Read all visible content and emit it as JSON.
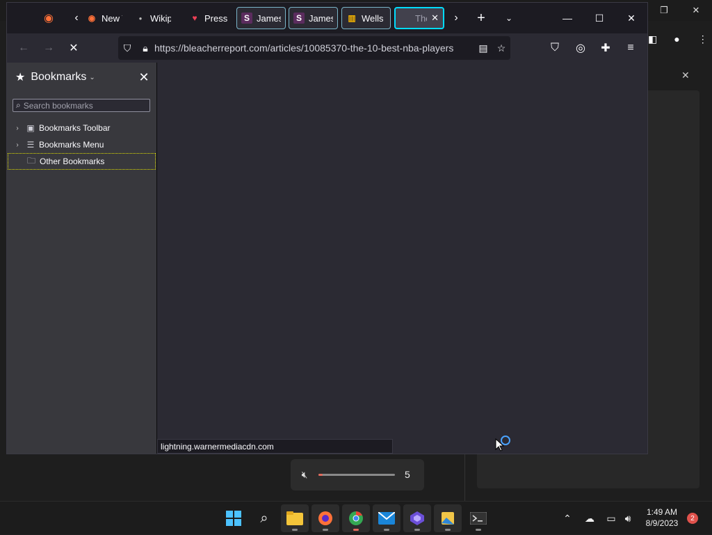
{
  "browser": {
    "tabs": [
      {
        "label": "New T",
        "icon": "firefox-icon"
      },
      {
        "label": "Wikip",
        "icon": "wikipedia-icon"
      },
      {
        "label": "Pressu",
        "icon": "pocket-icon"
      },
      {
        "label": "James",
        "icon": "s-logo-icon"
      },
      {
        "label": "James",
        "icon": "s-logo-icon"
      },
      {
        "label": "Wells",
        "icon": "chart-logo-icon"
      },
      {
        "label": "The",
        "icon": "loading-icon"
      }
    ],
    "url": "https://bleacherreport.com/articles/10085370-the-10-best-nba-players",
    "status_text": "lightning.warnermediacdn.com"
  },
  "sidebar": {
    "title": "Bookmarks",
    "search_placeholder": "Search bookmarks",
    "items": [
      {
        "label": "Bookmarks Toolbar"
      },
      {
        "label": "Bookmarks Menu"
      },
      {
        "label": "Other Bookmarks"
      }
    ]
  },
  "volume": {
    "value": "5",
    "level": 0.05
  },
  "taskbar": {
    "time": "1:49 AM",
    "date": "8/9/2023",
    "notification_count": "2"
  },
  "colors": {
    "accent": "#00ddff",
    "notification": "#e0524c"
  }
}
